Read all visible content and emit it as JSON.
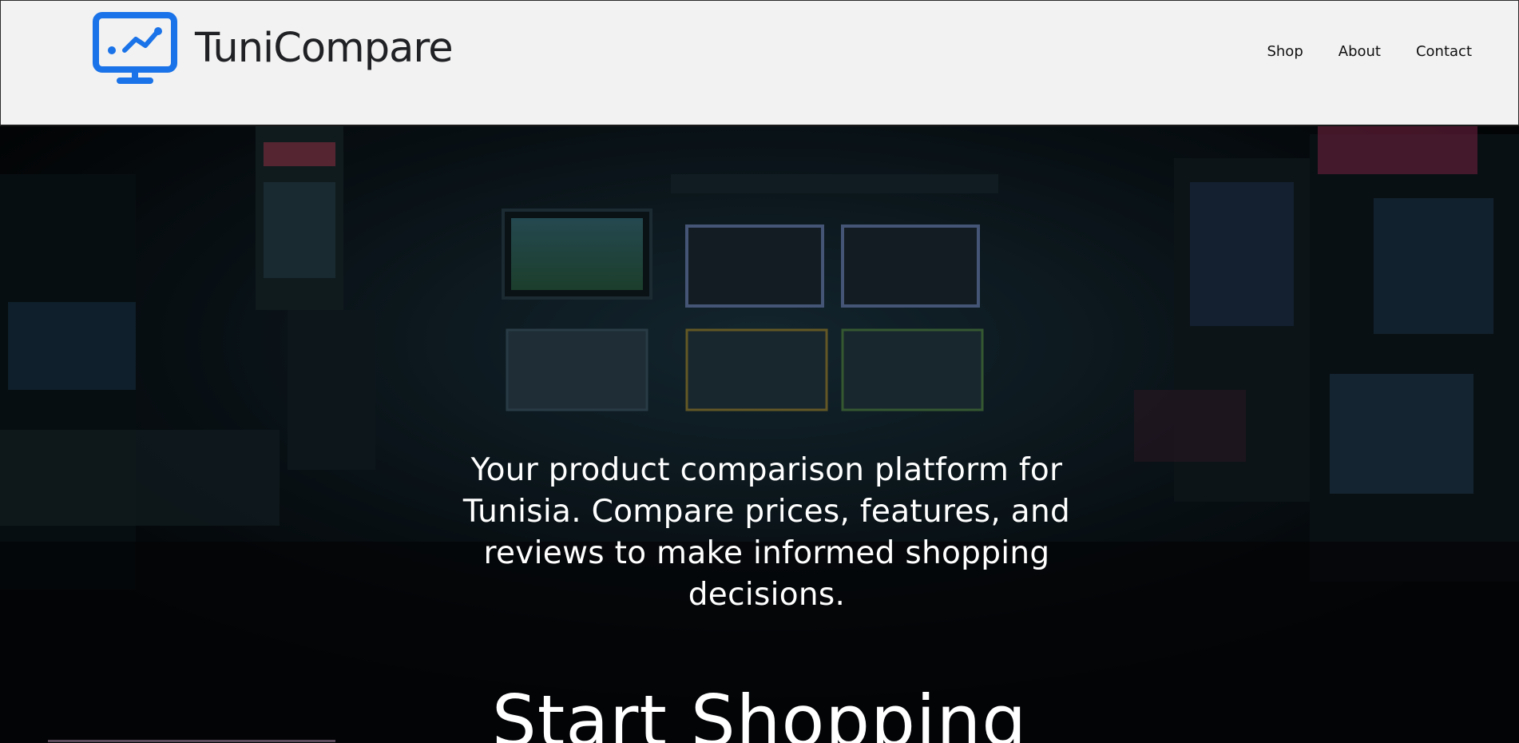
{
  "brand": {
    "name": "TuniCompare",
    "logo_icon": "monitor-chart-icon",
    "accent_color": "#1a73e8"
  },
  "nav": {
    "items": [
      {
        "label": "Shop"
      },
      {
        "label": "About"
      },
      {
        "label": "Contact"
      }
    ]
  },
  "hero": {
    "background": "dark-arcade-room-photo",
    "tagline": "Your product comparison platform for Tunisia. Compare prices, features, and reviews to make informed shopping decisions.",
    "cta_label": "Start Shopping"
  },
  "colors": {
    "header_bg": "#f2f2f2",
    "hero_overlay": "#06090c",
    "text_light": "#ffffff",
    "text_dark": "#202124"
  }
}
